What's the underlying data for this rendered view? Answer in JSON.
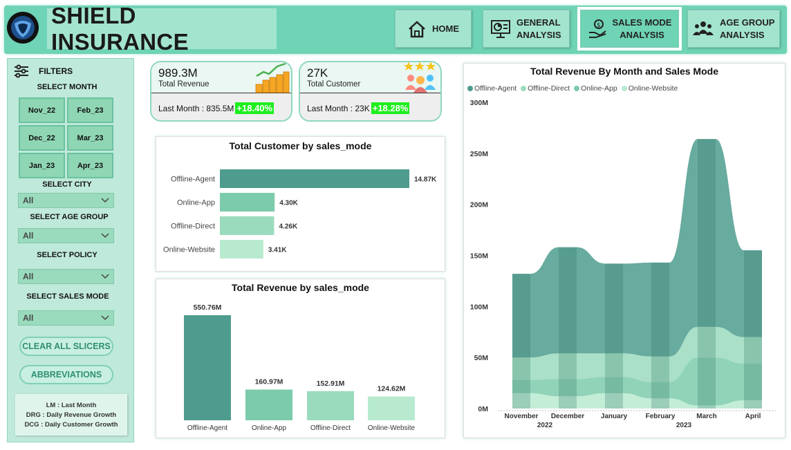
{
  "header": {
    "title": "SHIELD INSURANCE",
    "nav": [
      {
        "label": "HOME"
      },
      {
        "label": "GENERAL ANALYSIS"
      },
      {
        "label": "SALES MODE ANALYSIS"
      },
      {
        "label": "AGE GROUP ANALYSIS"
      }
    ]
  },
  "sidebar": {
    "filters_label": "FILTERS",
    "month_label": "SELECT MONTH",
    "months": [
      "Nov_22",
      "Feb_23",
      "Dec_22",
      "Mar_23",
      "Jan_23",
      "Apr_23"
    ],
    "city_label": "SELECT CITY",
    "city_value": "All",
    "age_label": "SELECT  AGE GROUP",
    "age_value": "All",
    "policy_label": "SELECT POLICY",
    "policy_value": "All",
    "sales_label": "SELECT SALES MODE",
    "sales_value": "All",
    "clear_button": "CLEAR ALL SLICERS",
    "abbr_button": "ABBREVIATIONS",
    "abbreviations": [
      "LM : Last Month",
      "DRG : Daily Revenue Growth",
      "DCG : Daily Customer Growth"
    ]
  },
  "kpis": {
    "revenue": {
      "value": "989.3M",
      "caption": "Total Revenue",
      "last_month": "Last Month : 835.5M",
      "growth": "+18.40%"
    },
    "customers": {
      "value": "27K",
      "caption": "Total Customer",
      "last_month": "Last Month : 23K",
      "growth": "+18.28%"
    }
  },
  "colors": {
    "accent": "#6fd3b5",
    "agent": "#4e9c8e",
    "app": "#7ccbab",
    "direct": "#9bdbbd",
    "website": "#b8ead0"
  },
  "chart_data": [
    {
      "type": "bar",
      "orientation": "horizontal",
      "title": "Total Customer by sales_mode",
      "categories": [
        "Offline-Agent",
        "Online-App",
        "Offline-Direct",
        "Online-Website"
      ],
      "values": [
        14.87,
        4.3,
        4.26,
        3.41
      ],
      "value_labels": [
        "14.87K",
        "4.30K",
        "4.26K",
        "3.41K"
      ]
    },
    {
      "type": "bar",
      "title": "Total Revenue by sales_mode",
      "categories": [
        "Offline-Agent",
        "Online-App",
        "Offline-Direct",
        "Online-Website"
      ],
      "values": [
        550.76,
        160.97,
        152.91,
        124.62
      ],
      "value_labels": [
        "550.76M",
        "160.97M",
        "152.91M",
        "124.62M"
      ]
    },
    {
      "type": "area",
      "title": "Total Revenue By Month and Sales Mode",
      "categories": [
        "November",
        "December",
        "January",
        "February",
        "March",
        "April"
      ],
      "year_labels": [
        "2022",
        "2023"
      ],
      "y_ticks": [
        "300M",
        "250M",
        "200M",
        "150M",
        "100M",
        "50M",
        "0M"
      ],
      "ylim": [
        0,
        300
      ],
      "legend_position": "top-left",
      "series": [
        {
          "name": "Offline-Agent",
          "values": [
            82,
            104,
            88,
            92,
            184,
            85
          ]
        },
        {
          "name": "Offline-Direct",
          "values": [
            22,
            25,
            23,
            25,
            30,
            26
          ]
        },
        {
          "name": "Online-App",
          "values": [
            13,
            17,
            16,
            16,
            47,
            36
          ]
        },
        {
          "name": "Online-Website",
          "values": [
            15,
            12,
            15,
            10,
            3,
            8
          ]
        }
      ]
    }
  ]
}
